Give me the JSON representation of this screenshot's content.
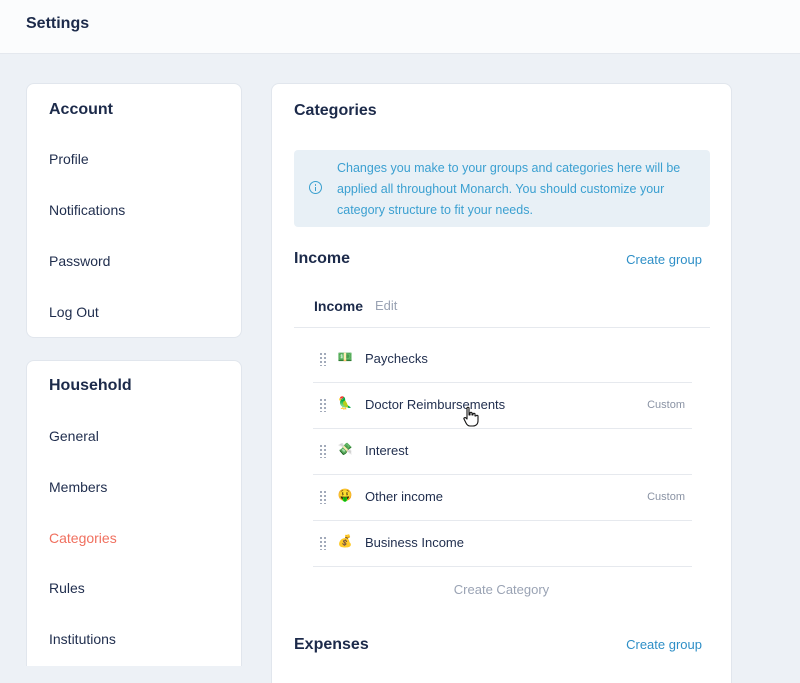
{
  "header": {
    "title": "Settings"
  },
  "sidebar": {
    "account": {
      "title": "Account",
      "items": [
        "Profile",
        "Notifications",
        "Password",
        "Log Out"
      ]
    },
    "household": {
      "title": "Household",
      "items": [
        "General",
        "Members",
        "Categories",
        "Rules",
        "Institutions"
      ],
      "active": "Categories"
    }
  },
  "main": {
    "title": "Categories",
    "info_text": "Changes you make to your groups and categories here will be applied all throughout Monarch. You should customize your category structure to fit your needs.",
    "income_section": {
      "title": "Income",
      "create_group_label": "Create group",
      "group": {
        "name": "Income",
        "edit_label": "Edit",
        "categories": [
          {
            "icon": "💵",
            "name": "Paychecks",
            "badge": ""
          },
          {
            "icon": "🦜",
            "name": "Doctor Reimbursements",
            "badge": "Custom"
          },
          {
            "icon": "💸",
            "name": "Interest",
            "badge": ""
          },
          {
            "icon": "🤑",
            "name": "Other income",
            "badge": "Custom"
          },
          {
            "icon": "💰",
            "name": "Business Income",
            "badge": ""
          }
        ],
        "create_category_label": "Create Category"
      }
    },
    "expenses_section": {
      "title": "Expenses",
      "create_group_label": "Create group"
    }
  },
  "colors": {
    "background": "#edf1f6",
    "active_nav": "#f0705f",
    "link": "#2e8fc7",
    "info_text": "#3ba0d1",
    "info_bg": "#e8f0f6"
  }
}
